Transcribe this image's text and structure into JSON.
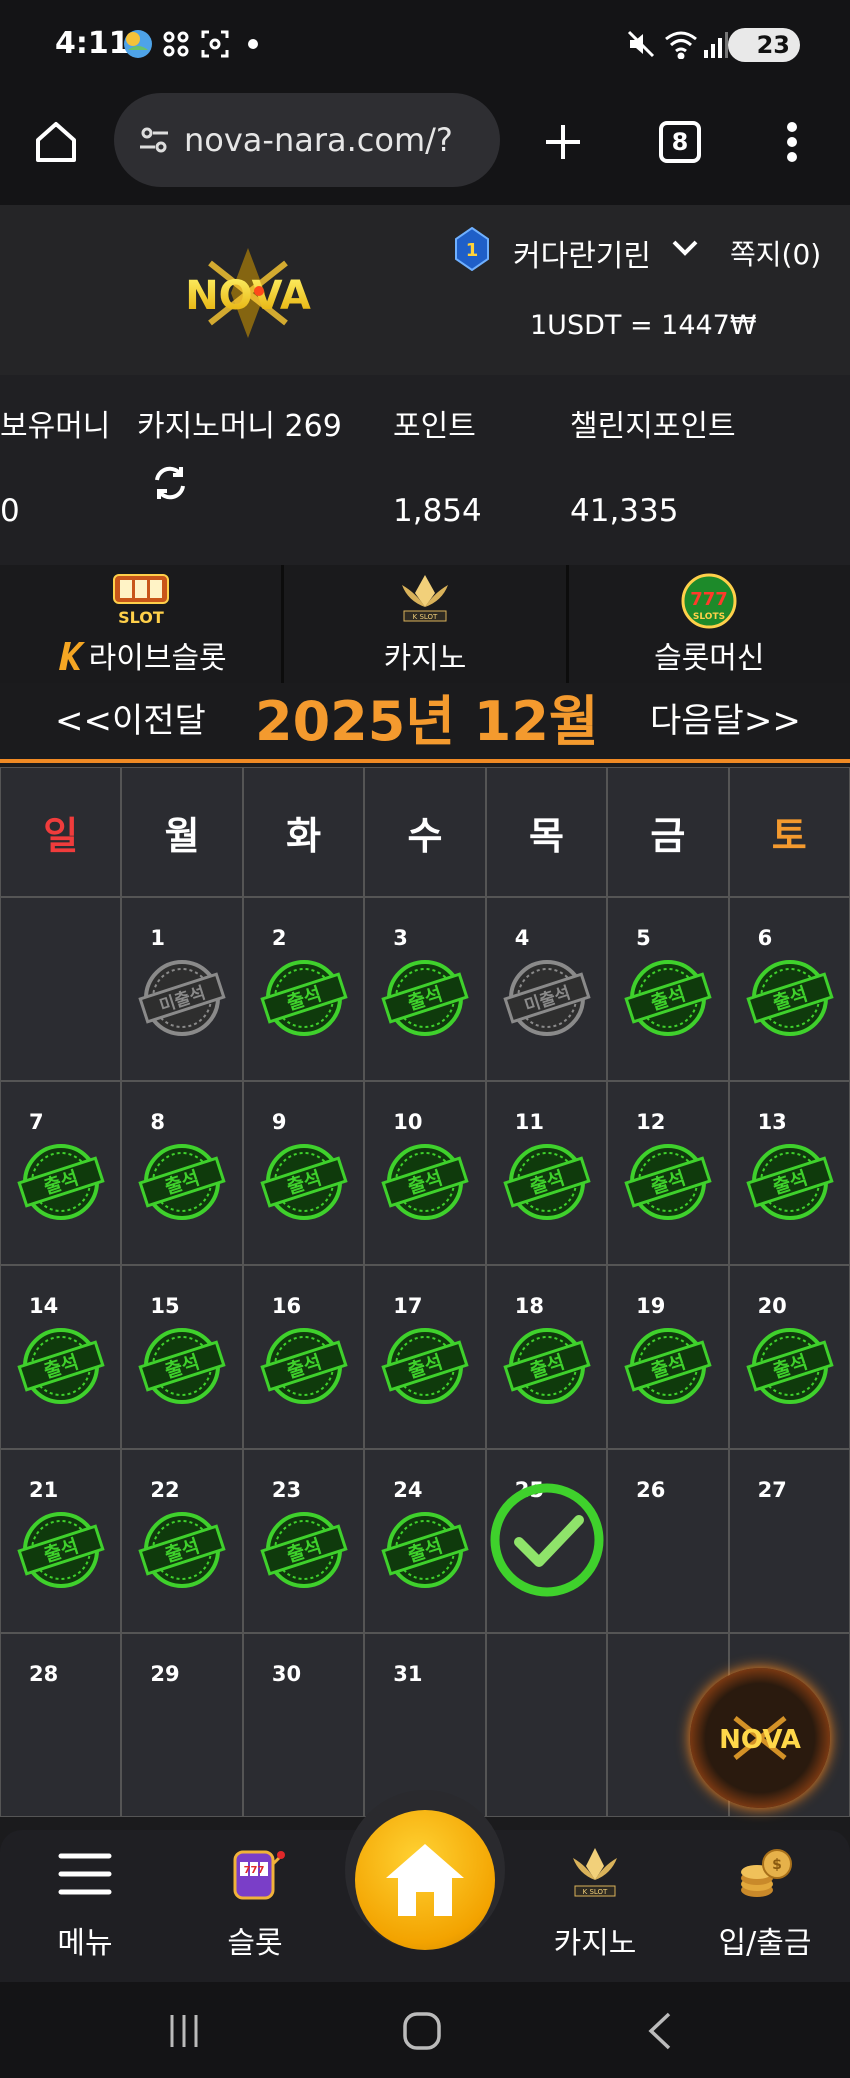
{
  "status_bar": {
    "time": "4:11",
    "battery": "23"
  },
  "browser": {
    "url": "nova-nara.com/?",
    "tab_count": "8"
  },
  "header": {
    "logo_text": "NOVA",
    "username": "커다란기린",
    "rank": "1",
    "memo": "쪽지(0)",
    "exchange_rate": "1USDT = 1447₩"
  },
  "balance": {
    "holding_label": "보유머니",
    "holding_value": "0",
    "casino_label": "카지노머니 269",
    "point_label": "포인트",
    "point_value": "1,854",
    "challenge_label": "챌린지포인트",
    "challenge_value": "41,335"
  },
  "categories": [
    {
      "label": "라이브슬롯",
      "icon": "live-slot-icon"
    },
    {
      "label": "카지노",
      "icon": "k-slot-icon"
    },
    {
      "label": "슬롯머신",
      "icon": "777-slots-icon"
    }
  ],
  "month_nav": {
    "prev": "<<이전달",
    "title": "2025년 12월",
    "next": "다음달>>"
  },
  "calendar": {
    "weekdays": [
      "일",
      "월",
      "화",
      "수",
      "목",
      "금",
      "토"
    ],
    "weekday_colors": [
      "#f03c3c",
      "#ffffff",
      "#ffffff",
      "#ffffff",
      "#ffffff",
      "#ffffff",
      "#f49a2e"
    ],
    "attended_label": "출석",
    "absent_label": "미출석",
    "days": [
      {
        "day": "",
        "status": "empty"
      },
      {
        "day": "1",
        "status": "absent"
      },
      {
        "day": "2",
        "status": "attended"
      },
      {
        "day": "3",
        "status": "attended"
      },
      {
        "day": "4",
        "status": "absent"
      },
      {
        "day": "5",
        "status": "attended"
      },
      {
        "day": "6",
        "status": "attended"
      },
      {
        "day": "7",
        "status": "attended"
      },
      {
        "day": "8",
        "status": "attended"
      },
      {
        "day": "9",
        "status": "attended"
      },
      {
        "day": "10",
        "status": "attended"
      },
      {
        "day": "11",
        "status": "attended"
      },
      {
        "day": "12",
        "status": "attended"
      },
      {
        "day": "13",
        "status": "attended"
      },
      {
        "day": "14",
        "status": "attended"
      },
      {
        "day": "15",
        "status": "attended"
      },
      {
        "day": "16",
        "status": "attended"
      },
      {
        "day": "17",
        "status": "attended"
      },
      {
        "day": "18",
        "status": "attended"
      },
      {
        "day": "19",
        "status": "attended"
      },
      {
        "day": "20",
        "status": "attended"
      },
      {
        "day": "21",
        "status": "attended"
      },
      {
        "day": "22",
        "status": "attended"
      },
      {
        "day": "23",
        "status": "attended"
      },
      {
        "day": "24",
        "status": "attended"
      },
      {
        "day": "25",
        "status": "today"
      },
      {
        "day": "26",
        "status": "none"
      },
      {
        "day": "27",
        "status": "none"
      },
      {
        "day": "28",
        "status": "none"
      },
      {
        "day": "29",
        "status": "none"
      },
      {
        "day": "30",
        "status": "none"
      },
      {
        "day": "31",
        "status": "none"
      },
      {
        "day": "",
        "status": "empty"
      },
      {
        "day": "",
        "status": "empty"
      },
      {
        "day": "",
        "status": "empty"
      }
    ]
  },
  "bottom_nav": {
    "menu": "메뉴",
    "slot": "슬롯",
    "casino": "카지노",
    "deposit": "입/출금"
  },
  "colors": {
    "accent_orange": "#f49a2e",
    "attended_green": "#3fd12c",
    "absent_gray": "#8a8a8a",
    "home_yellow": "#f3a300"
  }
}
